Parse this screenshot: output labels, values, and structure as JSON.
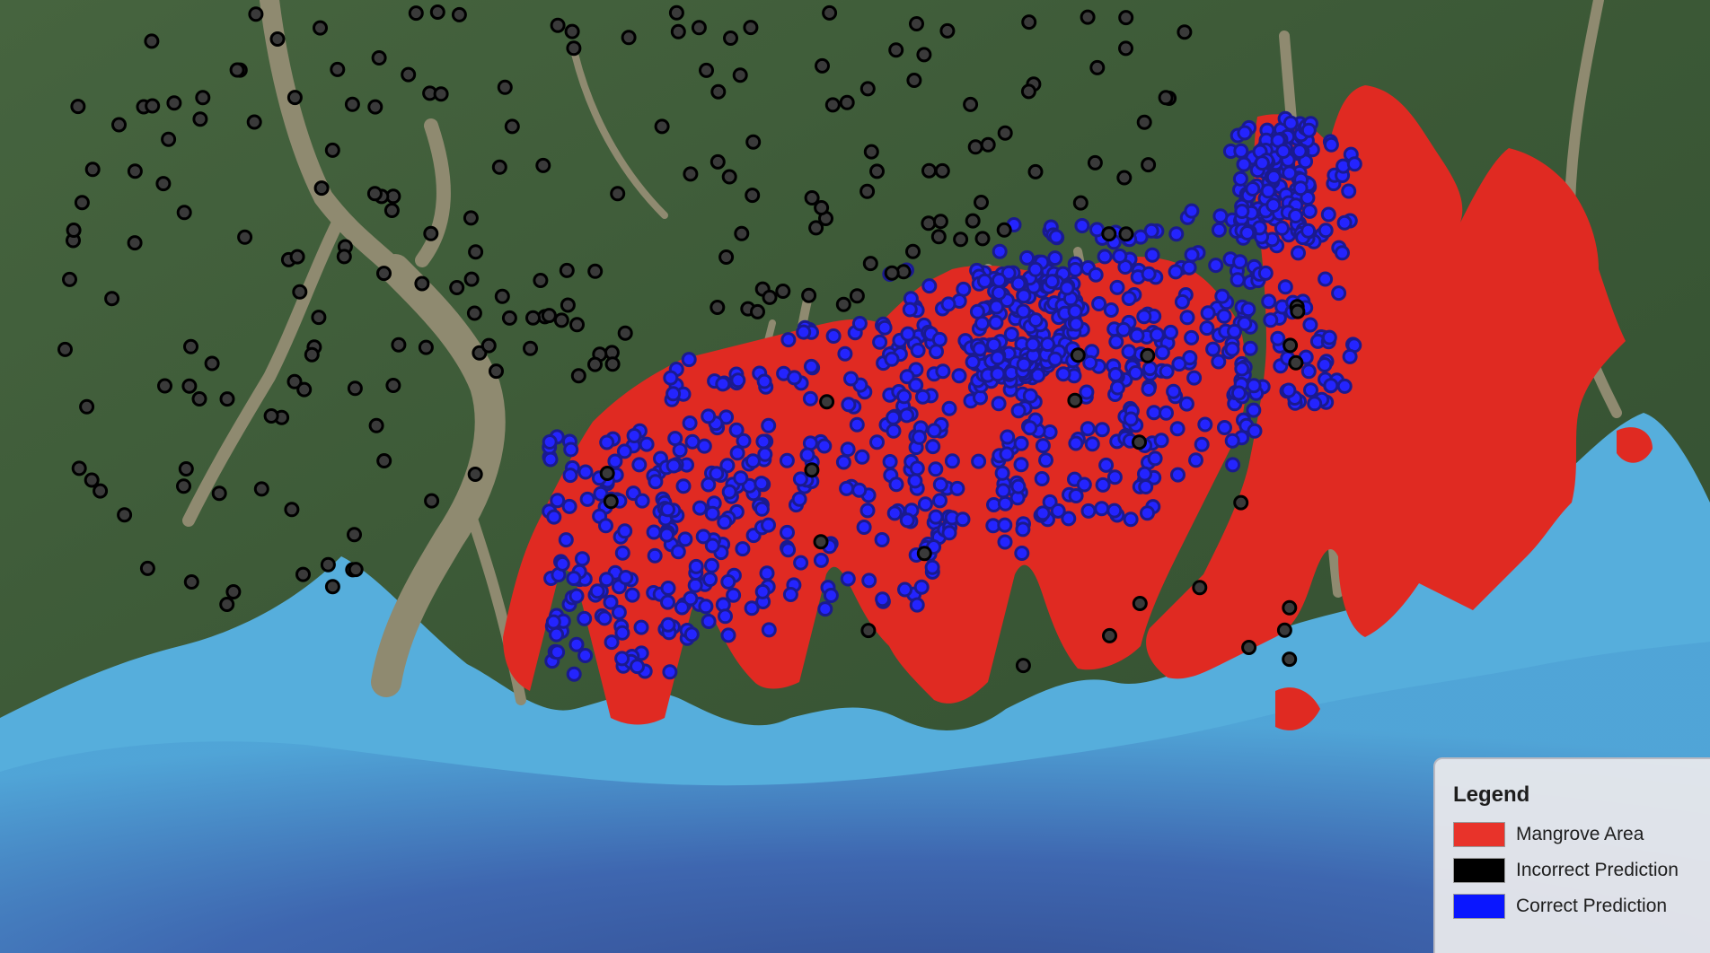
{
  "map": {
    "colors": {
      "land": "#3d5a37",
      "river": "#8a8a72",
      "water_shallow": "#5ba9d6",
      "water_deep": "#3a4f9c",
      "mangrove": "#e02a22",
      "incorrect": "#000000",
      "correct": "#1a1aff"
    }
  },
  "legend": {
    "title": "Legend",
    "items": [
      {
        "label": "Mangrove Area",
        "color": "#e8332a"
      },
      {
        "label": "Incorrect Prediction",
        "color": "#000000"
      },
      {
        "label": "Correct Prediction",
        "color": "#0a16ff"
      }
    ]
  }
}
